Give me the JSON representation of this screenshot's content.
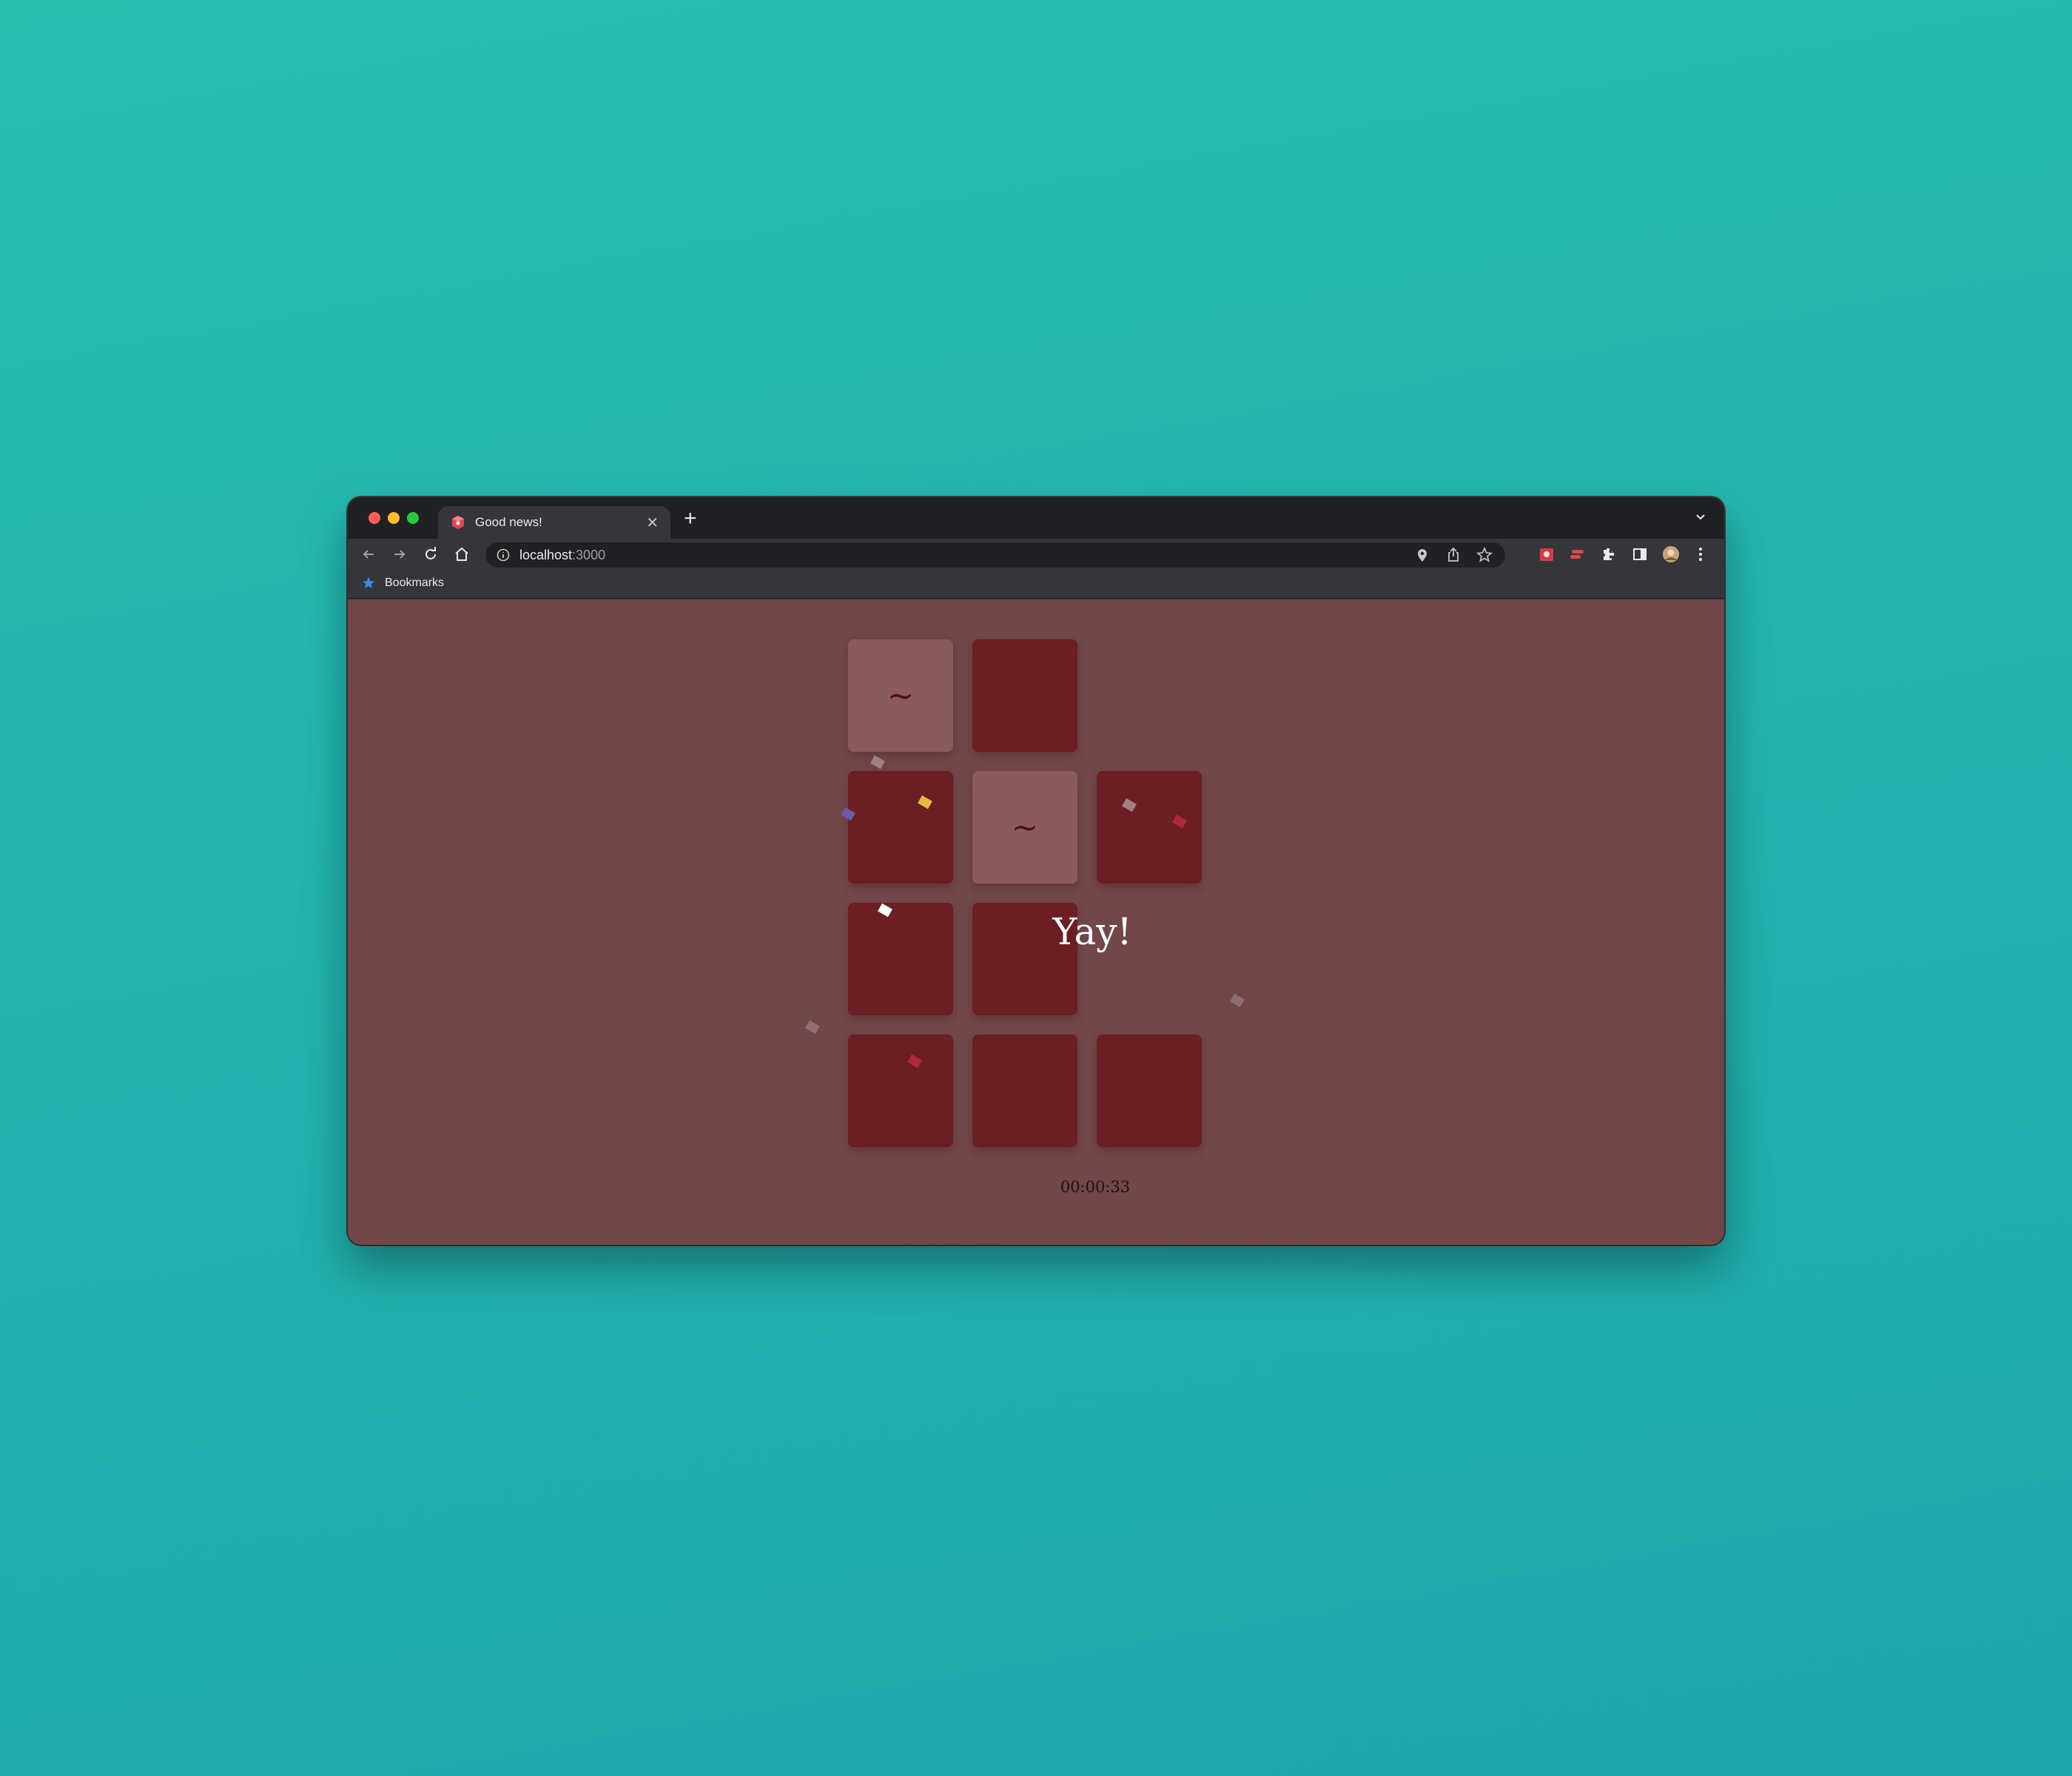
{
  "browser": {
    "tab_title": "Good news!",
    "url_host": "localhost",
    "url_port": ":3000",
    "bookmarks_label": "Bookmarks"
  },
  "game": {
    "cards": [
      {
        "id": "card-1-1",
        "state": "flipped",
        "symbol": "~"
      },
      {
        "id": "card-1-2",
        "state": "hidden",
        "symbol": ""
      },
      {
        "id": "card-2-1",
        "state": "hidden",
        "symbol": ""
      },
      {
        "id": "card-2-2",
        "state": "flipped",
        "symbol": "~"
      },
      {
        "id": "card-2-3",
        "state": "hidden",
        "symbol": ""
      },
      {
        "id": "card-3-1",
        "state": "hidden",
        "symbol": ""
      },
      {
        "id": "card-3-2",
        "state": "hidden",
        "symbol": ""
      },
      {
        "id": "card-4-1",
        "state": "hidden",
        "symbol": ""
      },
      {
        "id": "card-4-2",
        "state": "hidden",
        "symbol": ""
      },
      {
        "id": "card-4-3",
        "state": "hidden",
        "symbol": ""
      }
    ],
    "message": "Yay!",
    "timer": "00:00:33"
  },
  "colors": {
    "page_background": "#714749",
    "card_hidden": "#6b1e23",
    "card_flipped": "#8b5a5e"
  }
}
